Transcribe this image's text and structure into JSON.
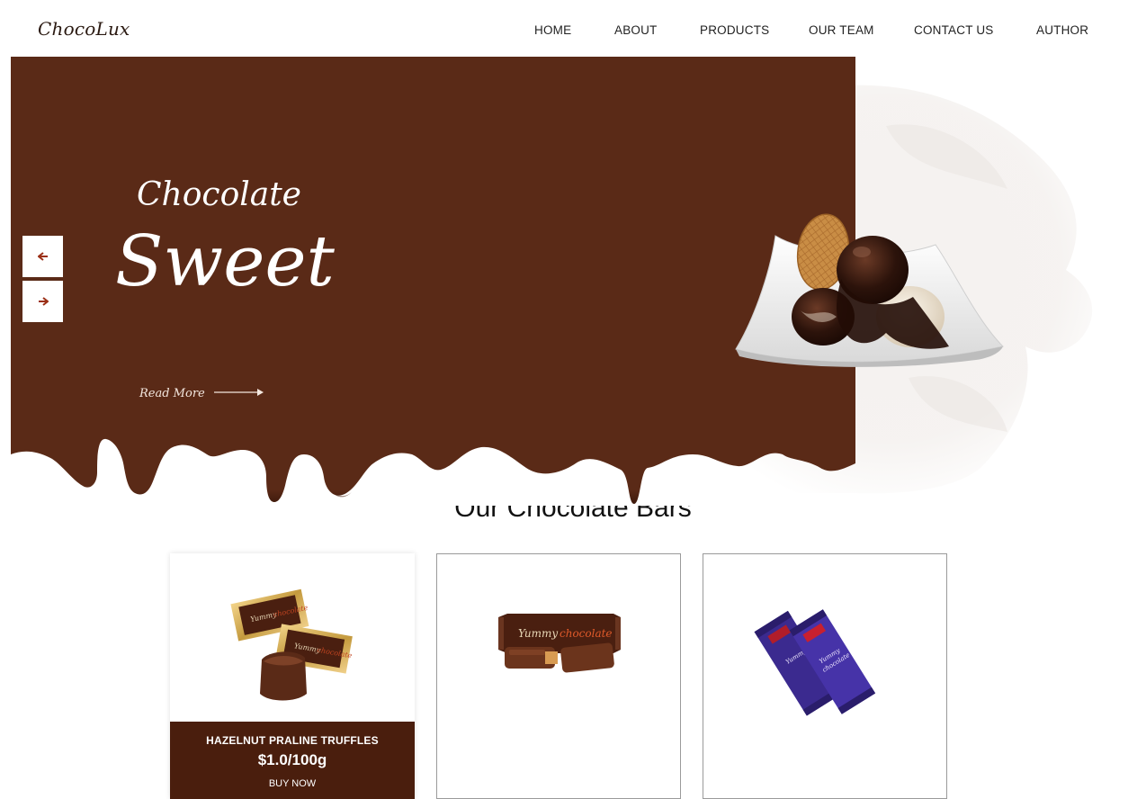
{
  "brand": {
    "logo": "ChocoLux"
  },
  "nav": {
    "items": [
      {
        "label": "HOME"
      },
      {
        "label": "ABOUT"
      },
      {
        "label": "PRODUCTS"
      },
      {
        "label": "OUR TEAM"
      },
      {
        "label": "CONTACT US"
      },
      {
        "label": "AUTHOR"
      }
    ]
  },
  "hero": {
    "subtitle": "Chocolate",
    "title": "Sweet",
    "read_more": "Read More",
    "prev_icon": "arrow-left-icon",
    "next_icon": "arrow-right-icon",
    "colors": {
      "background": "#5a2a17",
      "buttons": "#ffffff",
      "arrow": "#9b2f16"
    }
  },
  "products": {
    "section_title": "Our Chocolate Bars",
    "cards": [
      {
        "name": "HAZELNUT PRALINE TRUFFLES",
        "price": "$1.0/100g",
        "cta": "BUY NOW"
      },
      {
        "name": "",
        "price": "",
        "cta": ""
      },
      {
        "name": "",
        "price": "",
        "cta": ""
      }
    ],
    "colors": {
      "info_panel": "#4a1e0d"
    }
  }
}
